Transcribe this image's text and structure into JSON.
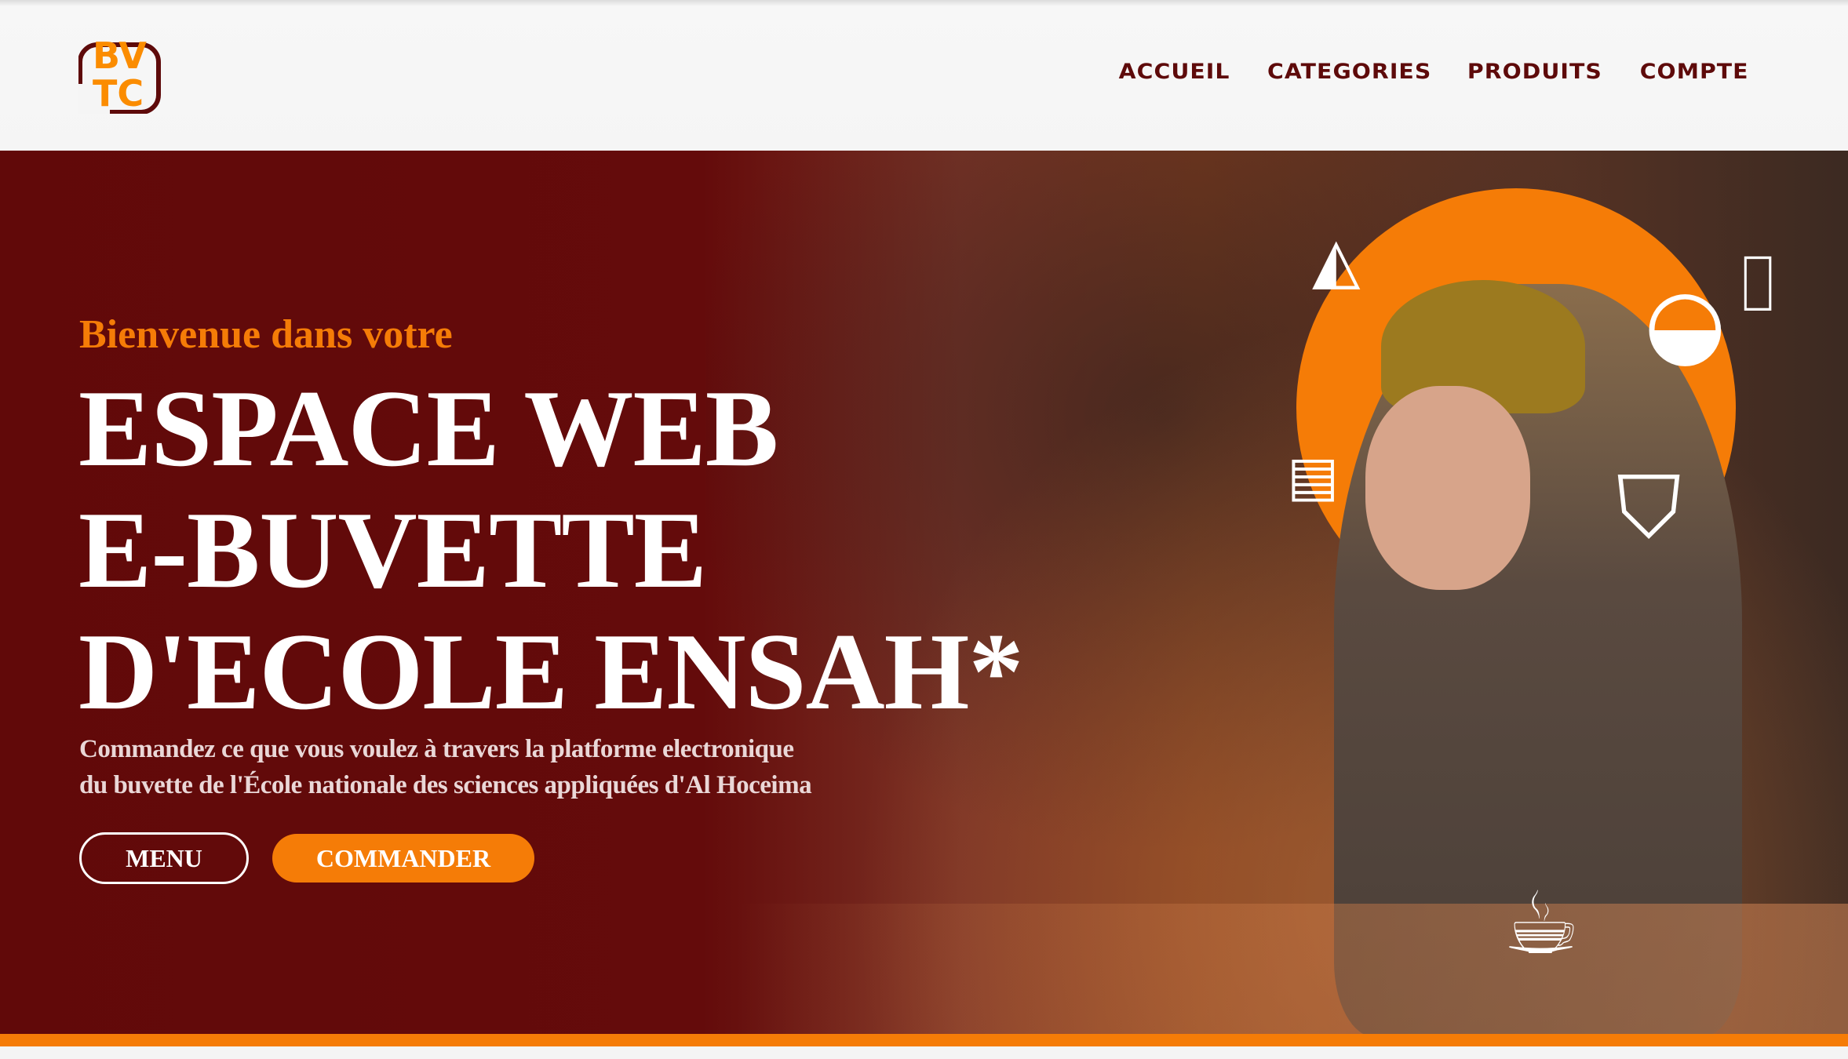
{
  "header": {
    "logo_text": "BVTC",
    "nav": [
      {
        "label": "ACCUEIL"
      },
      {
        "label": "CATEGORIES"
      },
      {
        "label": "PRODUITS"
      },
      {
        "label": "COMPTE"
      }
    ]
  },
  "hero": {
    "welcome": "Bienvenue dans votre",
    "title_lines": [
      "ESPACE WEB",
      "E-BUVETTE",
      "D'ECOLE ENSAH*"
    ],
    "subtitle_lines": [
      "Commandez ce que vous voulez à travers la platforme electronique",
      "du buvette de l'École nationale des sciences appliquées d'Al Hoceima"
    ],
    "buttons": {
      "menu": "MENU",
      "order": "COMMANDER"
    }
  },
  "colors": {
    "brand_dark": "#610909",
    "accent": "#f57c07",
    "header_bg": "#f5f5f5"
  },
  "icons": [
    "cake-icon",
    "burger-icon",
    "drink-icon",
    "fries-icon",
    "menu-card-icon",
    "coffee-cup-icon"
  ]
}
